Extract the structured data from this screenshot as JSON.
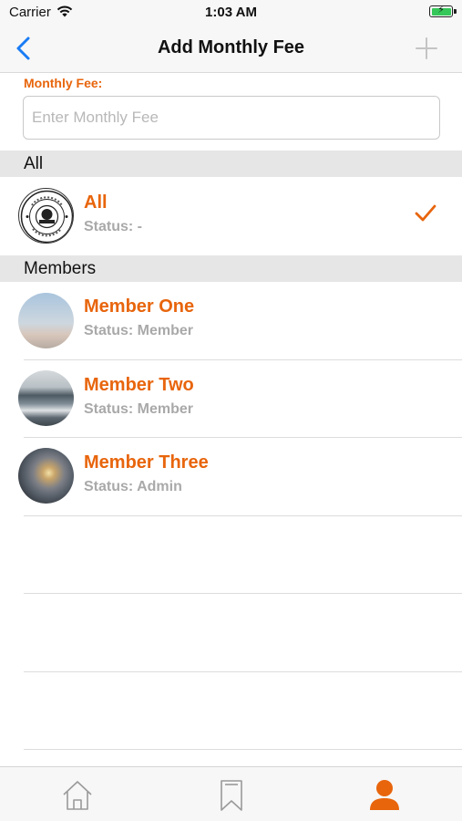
{
  "status_bar": {
    "carrier": "Carrier",
    "time": "1:03 AM"
  },
  "nav": {
    "title": "Add Monthly Fee",
    "back_icon": "chevron-left-icon",
    "add_icon": "plus-icon"
  },
  "form": {
    "fee_label": "Monthly Fee:",
    "fee_placeholder": "Enter Monthly Fee",
    "fee_value": ""
  },
  "sections": {
    "all_header": "All",
    "members_header": "Members"
  },
  "all_item": {
    "name": "All",
    "status": "Status: -",
    "selected": true
  },
  "members": [
    {
      "name": "Member One",
      "status": "Status: Member"
    },
    {
      "name": "Member Two",
      "status": "Status: Member"
    },
    {
      "name": "Member Three",
      "status": "Status: Admin"
    }
  ],
  "tabs": [
    {
      "icon": "home-icon",
      "active": false
    },
    {
      "icon": "bookmark-icon",
      "active": false
    },
    {
      "icon": "profile-icon",
      "active": true
    }
  ],
  "colors": {
    "accent": "#e8650c",
    "link": "#1a7cf5",
    "muted": "#a9a9a9"
  }
}
